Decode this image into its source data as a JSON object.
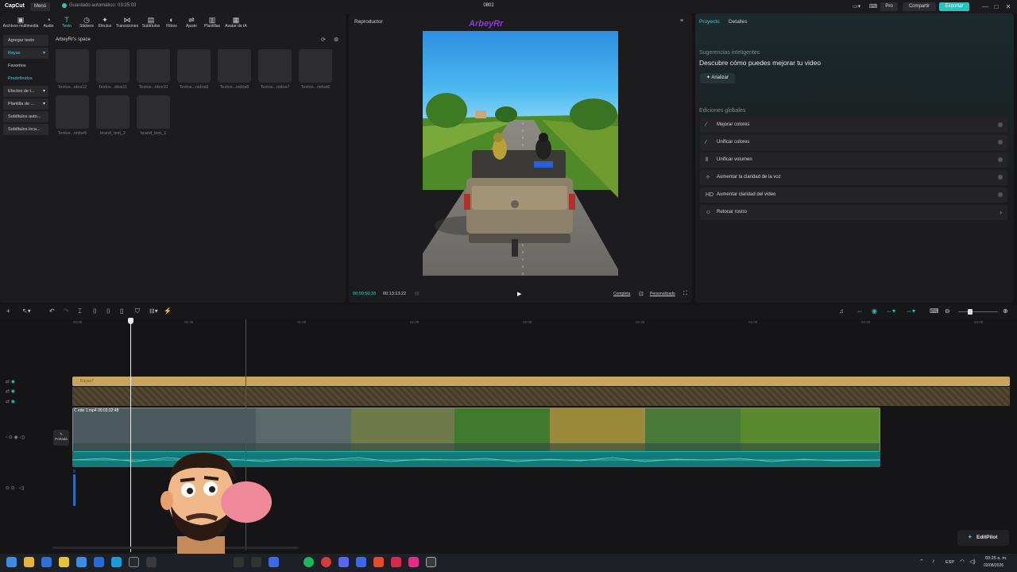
{
  "titlebar": {
    "logo": "CapCut",
    "menu": "Menú",
    "autosave": "Guardado automático: 03:25:03",
    "project_name": "0802",
    "pro": "Pro",
    "share": "Compartir",
    "export": "Exportar",
    "window_controls": [
      "—",
      "□",
      "✕"
    ]
  },
  "media_toolbar": {
    "tabs": [
      {
        "label": "Archivos multimedia",
        "icon": "media-icon"
      },
      {
        "label": "Audio",
        "icon": "audio-icon"
      },
      {
        "label": "Texto",
        "icon": "text-icon"
      },
      {
        "label": "Stickers",
        "icon": "sticker-icon"
      },
      {
        "label": "Efectos",
        "icon": "effects-icon"
      },
      {
        "label": "Transiciones",
        "icon": "transitions-icon"
      },
      {
        "label": "Subtítulos",
        "icon": "subtitles-icon"
      },
      {
        "label": "Filtros",
        "icon": "filters-icon"
      },
      {
        "label": "Ajuste",
        "icon": "adjust-icon"
      },
      {
        "label": "Plantillas",
        "icon": "templates-icon"
      },
      {
        "label": "Avatar de IA",
        "icon": "avatar-icon"
      }
    ],
    "active": "Texto"
  },
  "side_nav": {
    "items": [
      {
        "label": "Agregar texto"
      },
      {
        "label": "Rayas"
      },
      {
        "label": "Favoritos"
      },
      {
        "label": "Predefinidos"
      },
      {
        "label": "Efectos de t..."
      },
      {
        "label": "Plantilla de ..."
      },
      {
        "label": "Subtítulos auto..."
      },
      {
        "label": "Subtítulos loca..."
      }
    ]
  },
  "space": {
    "title": "ArbeyRr's space",
    "items": [
      "Textos...idos12",
      "Textos...idos11",
      "Textos...idos10",
      "Textos...nidos9",
      "Textos...nidos8",
      "Textos...nidos7",
      "Textos...nidos6",
      "Textos...nidos5",
      "brand_text_2",
      "brand_text_1"
    ]
  },
  "player": {
    "title": "Reproductor",
    "watermark": "ArbeyRr",
    "current_time": "00:00:50:33",
    "total_time": "00:13:13:22",
    "ratio": "Completa",
    "custom": "Personalizado"
  },
  "right_panel": {
    "tabs": [
      "Proyecto",
      "Detalles"
    ],
    "smart_title": "Sugerencias inteligentes",
    "smart_desc": "Descubre cómo puedes mejorar tu video",
    "analyze": "Analizar",
    "global_title": "Ediciones globales",
    "options": [
      {
        "label": "Mejorar colores",
        "icon": "wand-icon"
      },
      {
        "label": "Unificar colores",
        "icon": "brush-icon"
      },
      {
        "label": "Unificar volumen",
        "icon": "volume-bars-icon"
      },
      {
        "label": "Aumentar la claridad de la voz",
        "icon": "voice-icon"
      },
      {
        "label": "Aumentar claridad del video",
        "icon": "hd-icon"
      },
      {
        "label": "Retocar rostro",
        "icon": "face-icon"
      }
    ]
  },
  "timeline": {
    "ruler": [
      "00:00",
      "00:30",
      "01:00",
      "01:30",
      "02:00",
      "02:30",
      "03:00",
      "03:30",
      "04:00"
    ],
    "text_track_label": "Rayas7",
    "clip_label": "C  ede 1.mp4   00:03:32:48",
    "cover_label": "Portada",
    "audio_marker": "0"
  },
  "editpilot": "EditPilot",
  "taskbar": {
    "lang": "ESP",
    "time": "03:25 a. m.",
    "date": "03/08/2026"
  },
  "colors": {
    "accent": "#22c6c0",
    "text_track": "#c7a55e",
    "audio_track": "#127a78"
  }
}
